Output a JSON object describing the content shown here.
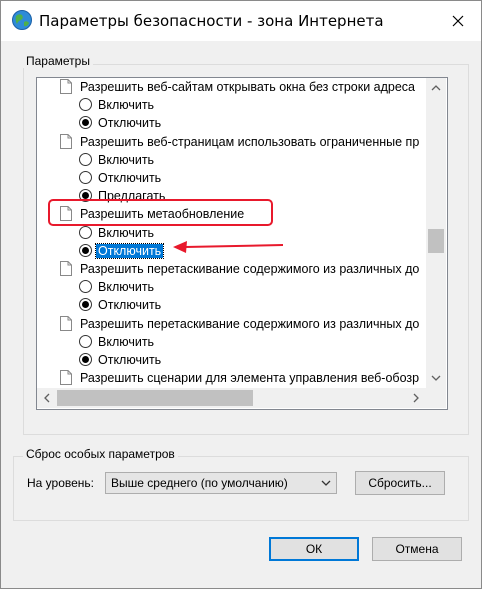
{
  "window": {
    "title": "Параметры безопасности - зона Интернета"
  },
  "params_group": {
    "legend": "Параметры"
  },
  "settings_list": {
    "items": [
      {
        "type": "setting",
        "label": "Разрешить веб-сайтам открывать окна без строки адреса"
      },
      {
        "type": "radio",
        "label": "Включить",
        "checked": false
      },
      {
        "type": "radio",
        "label": "Отключить",
        "checked": true
      },
      {
        "type": "setting",
        "label": "Разрешить веб-страницам использовать ограниченные пр"
      },
      {
        "type": "radio",
        "label": "Включить",
        "checked": false
      },
      {
        "type": "radio",
        "label": "Отключить",
        "checked": false
      },
      {
        "type": "radio",
        "label": "Предлагать",
        "checked": true
      },
      {
        "type": "setting",
        "label": "Разрешить метаобновление",
        "highlighted": true
      },
      {
        "type": "radio",
        "label": "Включить",
        "checked": false
      },
      {
        "type": "radio",
        "label": "Отключить",
        "checked": true,
        "selected": true
      },
      {
        "type": "setting",
        "label": "Разрешить перетаскивание содержимого из различных до"
      },
      {
        "type": "radio",
        "label": "Включить",
        "checked": false
      },
      {
        "type": "radio",
        "label": "Отключить",
        "checked": true
      },
      {
        "type": "setting",
        "label": "Разрешить перетаскивание содержимого из различных до"
      },
      {
        "type": "radio",
        "label": "Включить",
        "checked": false
      },
      {
        "type": "radio",
        "label": "Отключить",
        "checked": true
      },
      {
        "type": "setting",
        "label": "Разрешить сценарии для элемента управления веб-обозр"
      }
    ]
  },
  "reset_group": {
    "legend": "Сброс особых параметров",
    "level_label": "На уровень:",
    "level_value": "Выше среднего (по умолчанию)",
    "reset_button": "Сбросить..."
  },
  "footer": {
    "ok_button": "ОК",
    "cancel_button": "Отмена"
  },
  "colors": {
    "accent": "#0078d7",
    "annotation": "#e8192c"
  }
}
